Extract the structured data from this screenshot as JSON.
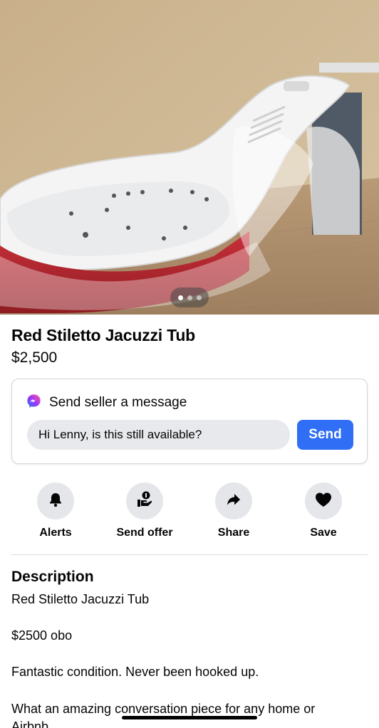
{
  "listing": {
    "title": "Red Stiletto Jacuzzi Tub",
    "price": "$2,500",
    "image_count": 3,
    "image_active_index": 0
  },
  "message": {
    "header_label": "Send seller a message",
    "input_value": "Hi Lenny, is this still available?",
    "send_label": "Send",
    "icon": "messenger-icon"
  },
  "actions": [
    {
      "label": "Alerts",
      "icon": "bell-icon"
    },
    {
      "label": "Send offer",
      "icon": "send-offer-icon"
    },
    {
      "label": "Share",
      "icon": "share-arrow-icon"
    },
    {
      "label": "Save",
      "icon": "heart-icon"
    }
  ],
  "description": {
    "heading": "Description",
    "lines": [
      "Red Stiletto Jacuzzi Tub",
      "$2500 obo",
      "Fantastic condition. Never been hooked up.",
      "What an amazing conversation piece for any home or",
      "Airbnb"
    ]
  },
  "colors": {
    "send_button": "#2f6ef5",
    "action_circle": "#e4e6ea",
    "input_bg": "#e8e9ec"
  }
}
